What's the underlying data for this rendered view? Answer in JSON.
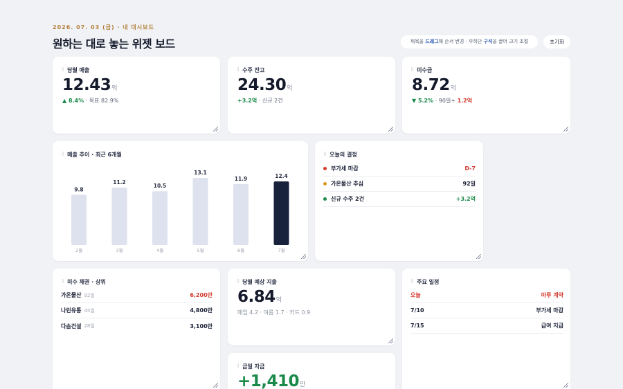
{
  "header": {
    "date": "2026. 07. 03 (금) · 내 대시보드",
    "title": "원하는 대로 놓는 위젯 보드",
    "hint_pre": "제목을 ",
    "hint_k1": "드래그",
    "hint_mid": "해 순서 변경 · 우하단 ",
    "hint_k2": "구석",
    "hint_post": "을 끌어 크기 조절",
    "reset_label": "초기화"
  },
  "widgets": {
    "sales": {
      "title": "당월 매출",
      "value": "12.43",
      "unit": "억",
      "delta": "▲ 8.4%",
      "note": "· 목표 82.9%"
    },
    "backlog": {
      "title": "수주 잔고",
      "value": "24.30",
      "unit": "억",
      "delta": "+3.2억",
      "note": "· 신규 2건"
    },
    "receivable": {
      "title": "미수금",
      "value": "8.72",
      "unit": "억",
      "delta": "▼ 5.2%",
      "note": "· 90일+",
      "overdue": "1.2억"
    },
    "trend": {
      "title": "매출 추이 · 최근 6개월"
    },
    "decisions": {
      "title": "오늘의 결정",
      "items": [
        {
          "label": "부가세 마감",
          "value": "D-7",
          "color": "#d33b2f"
        },
        {
          "label": "가온물산 추심",
          "value": "92일",
          "color": "#d69a1f"
        },
        {
          "label": "신규 수주 2건",
          "value": "+3.2억",
          "color": "#1c8a4a"
        }
      ]
    },
    "debtors": {
      "title": "미수 채권 · 상위",
      "items": [
        {
          "name": "가온물산",
          "days": "92일",
          "amount": "6,200만"
        },
        {
          "name": "나린유통",
          "days": "45일",
          "amount": "4,800만"
        },
        {
          "name": "다솜건설",
          "days": "28일",
          "amount": "3,100만"
        }
      ]
    },
    "expense": {
      "title": "당월 예상 지출",
      "value": "6.84",
      "unit": "억",
      "note": "매입 4.2 · 여름 1.7 · 카드 0.9"
    },
    "cash": {
      "title": "금일 자금",
      "value": "+1,410",
      "unit": "만"
    },
    "schedule": {
      "title": "주요 일정",
      "items": [
        {
          "date": "오늘",
          "label": "마루 계약"
        },
        {
          "date": "7/10",
          "label": "부가세 마감"
        },
        {
          "date": "7/15",
          "label": "급여 지급"
        }
      ]
    }
  },
  "chart_data": {
    "type": "bar",
    "title": "매출 추이 · 최근 6개월",
    "categories": [
      "2월",
      "3월",
      "4월",
      "5월",
      "6월",
      "7월"
    ],
    "values": [
      9.8,
      11.2,
      10.5,
      13.1,
      11.9,
      12.4
    ],
    "ylim": [
      0,
      14
    ],
    "highlight_index": 5,
    "colors": {
      "bar": "#dde2ee",
      "highlight": "#18223c",
      "label": "#2a3045",
      "tick": "#9aa0ad"
    }
  }
}
